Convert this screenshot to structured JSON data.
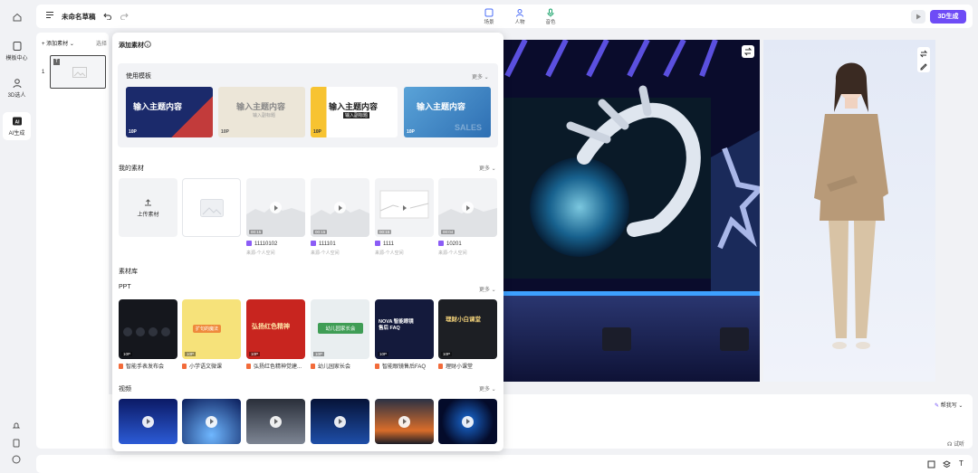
{
  "rail": {
    "home_icon": "home-icon",
    "items": [
      {
        "label": "模板中心",
        "icon": "template-icon"
      },
      {
        "label": "3D选人",
        "icon": "person-icon"
      },
      {
        "label": "AI生成",
        "icon": "ai-icon"
      }
    ],
    "bottom_icons": [
      "bell-icon",
      "document-icon",
      "help-icon"
    ]
  },
  "topbar": {
    "title": "未命名草稿",
    "tools": [
      {
        "label": "场景",
        "icon": "scene-icon"
      },
      {
        "label": "人物",
        "icon": "person-icon"
      },
      {
        "label": "音色",
        "icon": "mic-icon"
      }
    ],
    "generate_label": "3D生成"
  },
  "slides": {
    "add_label": "添加素材",
    "select_label": "选择",
    "index": "1",
    "thumb_badge": "T"
  },
  "popup": {
    "title": "添加素材",
    "templates": {
      "title": "使用模板",
      "more": "更多",
      "items": [
        {
          "text": "输入主题内容",
          "pages": "10P"
        },
        {
          "text": "输入主题内容",
          "sub": "输入副标题",
          "pages": "10P"
        },
        {
          "text": "输入主题内容",
          "sub": "输入副标题",
          "pages": "10P"
        },
        {
          "text": "输入主题内容",
          "pages": "10P",
          "watermark": "SALES"
        }
      ]
    },
    "mine": {
      "title": "我的素材",
      "more": "更多",
      "upload_label": "上传素材",
      "items": [
        {
          "name": "11110102",
          "sub": "来源-个人空间",
          "dur": "00:15"
        },
        {
          "name": "111101",
          "sub": "来源-个人空间",
          "dur": "00:15"
        },
        {
          "name": "1111",
          "sub": "来源-个人空间",
          "dur": "00:15"
        },
        {
          "name": "10201",
          "sub": "来源-个人空间",
          "dur": "00:04"
        }
      ]
    },
    "library": {
      "title": "素材库",
      "ppt": {
        "title": "PPT",
        "more": "更多",
        "items": [
          {
            "name": "智能手表发布会",
            "pages": "10P"
          },
          {
            "name": "小学语文微课",
            "pages": "10P",
            "text": "扩句的魔法"
          },
          {
            "name": "弘扬红色精神觉建...",
            "pages": "10P",
            "text": "弘扬红色精神"
          },
          {
            "name": "幼儿园家长会",
            "pages": "10P",
            "text": "幼儿园家长会"
          },
          {
            "name": "智能眼镜售后FAQ",
            "pages": "10P",
            "text": "NOVA 智能眼镜 售后 FAQ"
          },
          {
            "name": "理财小课堂",
            "pages": "10P",
            "text": "理财小白课堂"
          }
        ]
      },
      "video": {
        "title": "视频",
        "more": "更多"
      }
    }
  },
  "bottom": {
    "help_label": "帮我写",
    "listen_label": "试听",
    "tools": [
      "crop-icon",
      "layers-icon",
      "text-icon"
    ]
  },
  "colors": {
    "accent": "#6e4cf6"
  }
}
